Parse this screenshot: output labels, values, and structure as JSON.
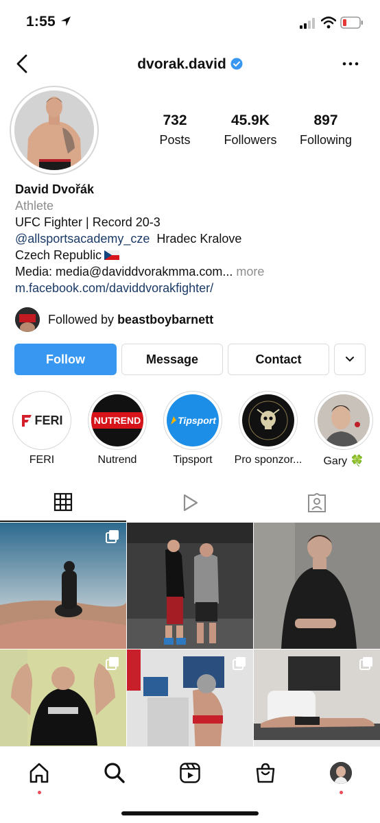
{
  "status_bar": {
    "time": "1:55"
  },
  "header": {
    "username": "dvorak.david"
  },
  "stats": [
    {
      "value": "732",
      "label": "Posts"
    },
    {
      "value": "45.9K",
      "label": "Followers"
    },
    {
      "value": "897",
      "label": "Following"
    }
  ],
  "bio": {
    "name": "David Dvořák",
    "category": "Athlete",
    "line1": "UFC Fighter | Record 20-3",
    "mention": "@allsportsacademy_cze",
    "location_city": "Hradec Kralove",
    "location_country": "Czech Republic",
    "media_text": "Media: media@daviddvorakmma.com...",
    "more": "more",
    "website": "m.facebook.com/daviddvorakfighter/"
  },
  "followed_by": {
    "prefix": "Followed by ",
    "user": "beastboybarnett"
  },
  "buttons": {
    "follow": "Follow",
    "message": "Message",
    "contact": "Contact"
  },
  "highlights": [
    {
      "label": "FERI",
      "text": "FERI"
    },
    {
      "label": "Nutrend",
      "text": "NUTREND"
    },
    {
      "label": "Tipsport",
      "text": "Tipsport"
    },
    {
      "label": "Pro sponzor..."
    },
    {
      "label": "Gary 🍀"
    }
  ],
  "colors": {
    "accent": "#3897f0",
    "link": "#1b3a66",
    "muted": "#8e8e8e",
    "verified": "#3897f0",
    "notification": "#ed4956"
  }
}
